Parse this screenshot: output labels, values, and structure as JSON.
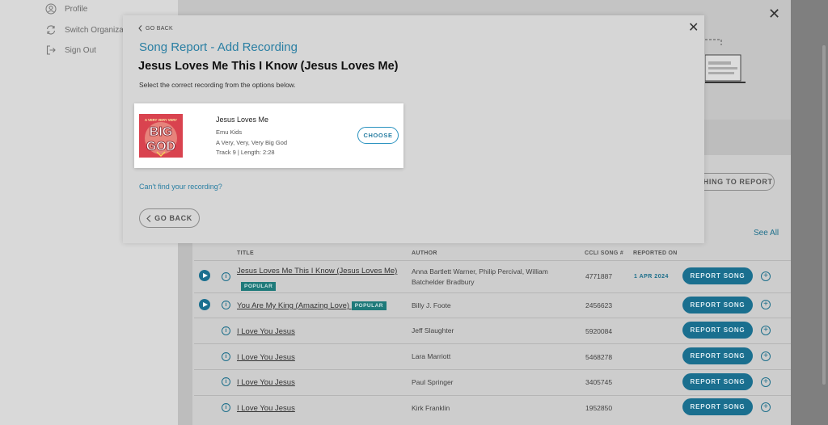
{
  "sidebar": {
    "items": [
      {
        "label": "Profile",
        "icon": "person-icon"
      },
      {
        "label": "Switch Organization",
        "icon": "switch-icon"
      },
      {
        "label": "Sign Out",
        "icon": "sign-out-icon"
      }
    ]
  },
  "background": {
    "nothing_to_report_label": "NOTHING TO REPORT",
    "see_all_label": "See All",
    "table": {
      "headers": {
        "title": "TITLE",
        "author": "AUTHOR",
        "ccli": "CCLI SONG #",
        "reported_on": "REPORTED ON"
      },
      "badge_label": "POPULAR",
      "report_button_label": "REPORT SONG",
      "rows": [
        {
          "title": "Jesus Loves Me This I Know (Jesus Loves Me)",
          "popular": true,
          "author": "Anna Bartlett Warner, Philip Percival, William Batchelder Bradbury",
          "ccli": "4771887",
          "reported_on": "1 APR 2024",
          "playable": true
        },
        {
          "title": "You Are My King (Amazing Love)",
          "popular": true,
          "author": "Billy J. Foote",
          "ccli": "2456623",
          "reported_on": "",
          "playable": true
        },
        {
          "title": "I Love You Jesus",
          "popular": false,
          "author": "Jeff Slaughter",
          "ccli": "5920084",
          "reported_on": "",
          "playable": false
        },
        {
          "title": "I Love You Jesus",
          "popular": false,
          "author": "Lara Marriott",
          "ccli": "5468278",
          "reported_on": "",
          "playable": false
        },
        {
          "title": "I Love You Jesus",
          "popular": false,
          "author": "Paul Springer",
          "ccli": "3405745",
          "reported_on": "",
          "playable": false
        },
        {
          "title": "I Love You Jesus",
          "popular": false,
          "author": "Kirk Franklin",
          "ccli": "1952850",
          "reported_on": "",
          "playable": false
        }
      ]
    }
  },
  "modal": {
    "go_back_top_label": "GO BACK",
    "subtitle": "Song Report - Add Recording",
    "title": "Jesus Loves Me This I Know (Jesus Loves Me)",
    "instructions": "Select the correct recording from the options below.",
    "recording": {
      "title": "Jesus Loves Me",
      "artist": "Emu Kids",
      "album": "A Very, Very, Very Big God",
      "track_label": "Track",
      "track_number": "9",
      "length_label": "Length:",
      "length": "2:28",
      "album_art_text": {
        "top": "A VERY VERY VERY",
        "big": "BIG",
        "god": "GOD"
      },
      "choose_label": "CHOOSE"
    },
    "cant_find_label": "Can't find your recording?",
    "go_back_button_label": "GO BACK"
  },
  "colors": {
    "accent": "#2a7fa3",
    "button_dark": "#1a6f8f",
    "badge": "#1f7a7a",
    "album_art": "#d9434f"
  }
}
